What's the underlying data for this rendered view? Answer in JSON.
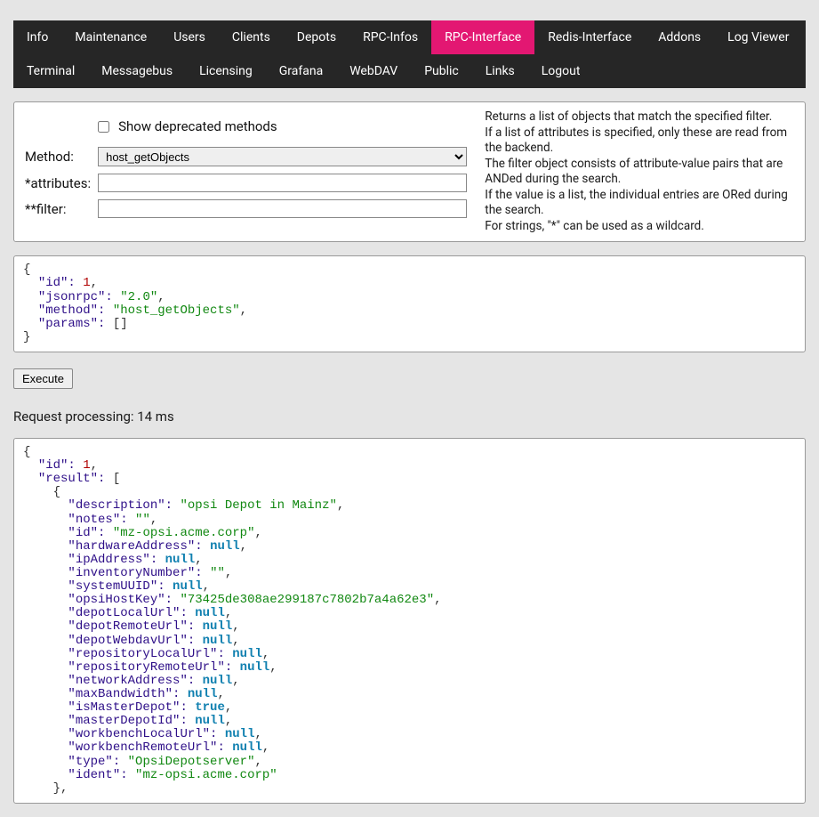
{
  "nav": {
    "items": [
      {
        "label": "Info",
        "active": false
      },
      {
        "label": "Maintenance",
        "active": false
      },
      {
        "label": "Users",
        "active": false
      },
      {
        "label": "Clients",
        "active": false
      },
      {
        "label": "Depots",
        "active": false
      },
      {
        "label": "RPC-Infos",
        "active": false
      },
      {
        "label": "RPC-Interface",
        "active": true
      },
      {
        "label": "Redis-Interface",
        "active": false
      },
      {
        "label": "Addons",
        "active": false
      },
      {
        "label": "Log Viewer",
        "active": false
      },
      {
        "label": "Terminal",
        "active": false
      },
      {
        "label": "Messagebus",
        "active": false
      },
      {
        "label": "Licensing",
        "active": false
      },
      {
        "label": "Grafana",
        "active": false
      },
      {
        "label": "WebDAV",
        "active": false
      },
      {
        "label": "Public",
        "active": false
      },
      {
        "label": "Links",
        "active": false
      },
      {
        "label": "Logout",
        "active": false
      }
    ]
  },
  "form": {
    "show_deprecated_label": "Show deprecated methods",
    "show_deprecated_checked": false,
    "method_label": "Method:",
    "method_value": "host_getObjects",
    "attributes_label": "*attributes:",
    "attributes_value": "",
    "filter_label": "**filter:",
    "filter_value": "",
    "help_text": "Returns a list of objects that match the specified filter.\nIf a list of attributes is specified, only these are read from the backend.\nThe filter object consists of attribute-value pairs that are ANDed during the search.\nIf the value is a list, the individual entries are ORed during the search.\nFor strings, \"*\" can be used as a wildcard."
  },
  "request_json": {
    "id": 1,
    "jsonrpc": "2.0",
    "method": "host_getObjects",
    "params": []
  },
  "execute_label": "Execute",
  "processing_text": "Request processing: 14 ms",
  "response_json": {
    "id": 1,
    "result": [
      {
        "description": "opsi Depot in Mainz",
        "notes": "",
        "id": "mz-opsi.acme.corp",
        "hardwareAddress": null,
        "ipAddress": null,
        "inventoryNumber": "",
        "systemUUID": null,
        "opsiHostKey": "73425de308ae299187c7802b7a4a62e3",
        "depotLocalUrl": null,
        "depotRemoteUrl": null,
        "depotWebdavUrl": null,
        "repositoryLocalUrl": null,
        "repositoryRemoteUrl": null,
        "networkAddress": null,
        "maxBandwidth": null,
        "isMasterDepot": true,
        "masterDepotId": null,
        "workbenchLocalUrl": null,
        "workbenchRemoteUrl": null,
        "type": "OpsiDepotserver",
        "ident": "mz-opsi.acme.corp"
      }
    ]
  }
}
